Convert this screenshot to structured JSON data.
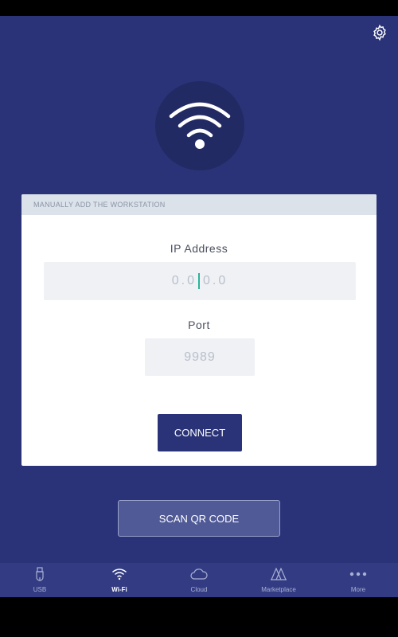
{
  "settings": {
    "icon": "gear-icon"
  },
  "hero": {
    "icon": "wifi-icon"
  },
  "card": {
    "header": "MANUALLY ADD THE WORKSTATION",
    "ip_label": "IP Address",
    "ip_left": "0.0",
    "ip_right": "0.0",
    "port_label": "Port",
    "port_placeholder": "9989",
    "connect_label": "CONNECT"
  },
  "scan_label": "SCAN QR CODE",
  "tabs": [
    {
      "label": "USB",
      "icon": "usb-icon",
      "active": false
    },
    {
      "label": "Wi-Fi",
      "icon": "wifi-icon",
      "active": true
    },
    {
      "label": "Cloud",
      "icon": "cloud-icon",
      "active": false
    },
    {
      "label": "Marketplace",
      "icon": "marketplace-icon",
      "active": false
    },
    {
      "label": "More",
      "icon": "more-icon",
      "active": false
    }
  ],
  "colors": {
    "background": "#2a3378",
    "tabbar": "#333c83",
    "accent_cursor": "#2bb39b"
  }
}
